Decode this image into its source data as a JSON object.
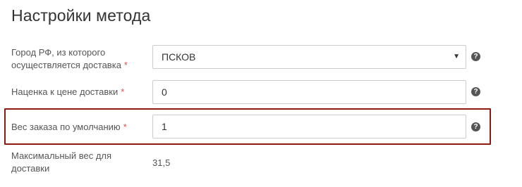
{
  "section": {
    "title": "Настройки метода"
  },
  "fields": {
    "city": {
      "label": "Город РФ, из которого осуществляется доставка",
      "required_mark": "*",
      "value": "ПСКОВ"
    },
    "markup": {
      "label": "Наценка к цене доставки",
      "required_mark": "*",
      "value": "0"
    },
    "weight": {
      "label": "Вес заказа по умолчанию",
      "required_mark": "*",
      "value": "1"
    },
    "max_weight": {
      "label": "Максимальный вес для доставки",
      "value": "31,5"
    }
  },
  "help_glyph": "?",
  "select_caret": "▼",
  "colors": {
    "highlight_border": "#8b1a10",
    "required": "#d9534f",
    "help_icon_bg": "#555555"
  },
  "icons": {
    "help": "question-circle-icon",
    "select": "chevron-down-icon"
  }
}
